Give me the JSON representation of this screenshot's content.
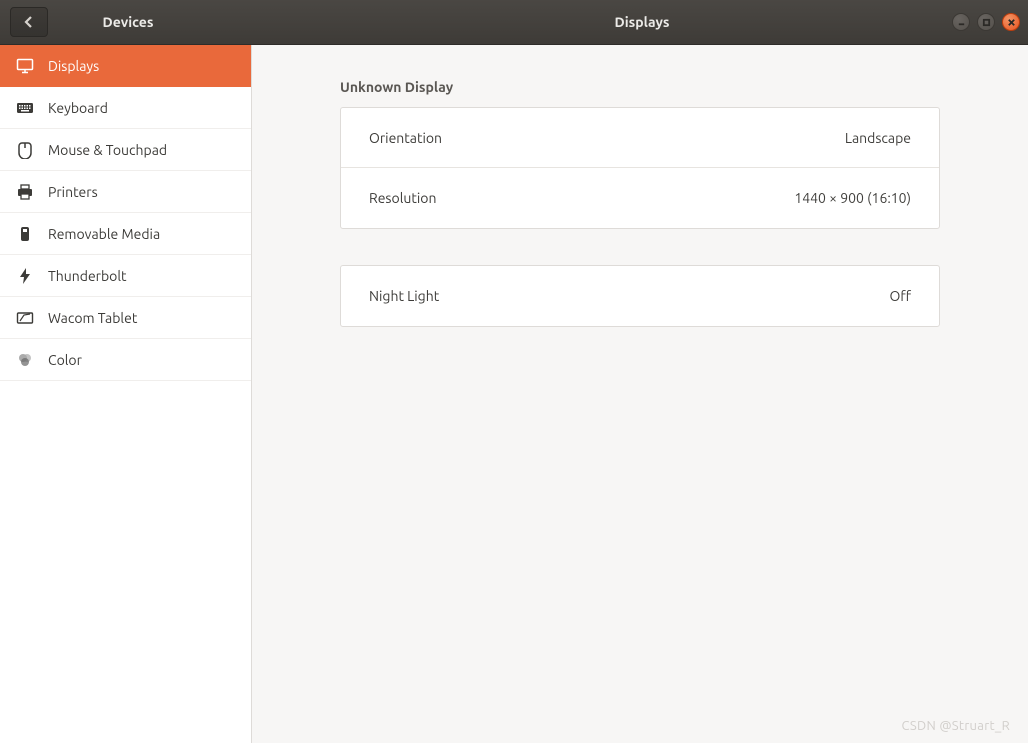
{
  "titlebar": {
    "sidebar_title": "Devices",
    "main_title": "Displays"
  },
  "sidebar": {
    "items": [
      {
        "label": "Displays",
        "icon": "displays-icon",
        "active": true
      },
      {
        "label": "Keyboard",
        "icon": "keyboard-icon",
        "active": false
      },
      {
        "label": "Mouse & Touchpad",
        "icon": "mouse-icon",
        "active": false
      },
      {
        "label": "Printers",
        "icon": "printers-icon",
        "active": false
      },
      {
        "label": "Removable Media",
        "icon": "removable-media-icon",
        "active": false
      },
      {
        "label": "Thunderbolt",
        "icon": "thunderbolt-icon",
        "active": false
      },
      {
        "label": "Wacom Tablet",
        "icon": "wacom-tablet-icon",
        "active": false
      },
      {
        "label": "Color",
        "icon": "color-icon",
        "active": false
      }
    ]
  },
  "main": {
    "heading": "Unknown Display",
    "display_panel": {
      "orientation": {
        "label": "Orientation",
        "value": "Landscape"
      },
      "resolution": {
        "label": "Resolution",
        "value": "1440 × 900 (16:10)"
      }
    },
    "night_panel": {
      "night_light": {
        "label": "Night Light",
        "value": "Off"
      }
    }
  },
  "watermark": "CSDN @Struart_R"
}
